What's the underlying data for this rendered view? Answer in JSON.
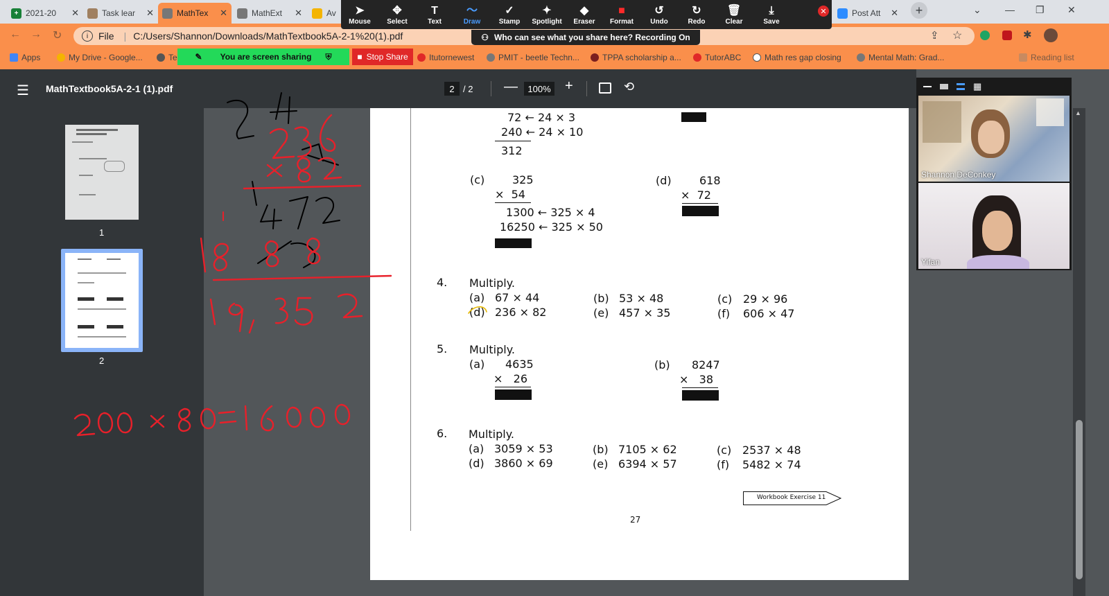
{
  "browser": {
    "tabs": [
      {
        "title": "2021-20",
        "fav_color": "#188038",
        "fav_glyph": "+"
      },
      {
        "title": "Task lear",
        "fav_color": "#a08060",
        "fav_glyph": ""
      },
      {
        "title": "MathTex",
        "fav_color": "#777777",
        "fav_glyph": ""
      },
      {
        "title": "MathExt",
        "fav_color": "#777777",
        "fav_glyph": ""
      },
      {
        "title": "Av",
        "fav_color": "#f4b400",
        "fav_glyph": ""
      },
      {
        "title": "Post Att",
        "fav_color": "#2d8cff",
        "fav_glyph": ""
      }
    ],
    "address": "C:/Users/Shannon/Downloads/MathTextbook5A-2-1%20(1).pdf",
    "file_label": "File",
    "bookmarks": [
      "Apps",
      "My Drive - Google...",
      "Te",
      "Itutornewest",
      "PMIT - beetle Techn...",
      "TPPA scholarship a...",
      "TutorABC",
      "Math res gap closing",
      "Mental Math: Grad...",
      "Reading list"
    ]
  },
  "annotate_toolbar": {
    "tools": [
      {
        "label": "Mouse",
        "icon": "mouse-icon",
        "glyph": "➤"
      },
      {
        "label": "Select",
        "icon": "select-icon",
        "glyph": "✥"
      },
      {
        "label": "Text",
        "icon": "text-icon",
        "glyph": "T"
      },
      {
        "label": "Draw",
        "icon": "draw-icon",
        "glyph": "〜"
      },
      {
        "label": "Stamp",
        "icon": "stamp-icon",
        "glyph": "✓"
      },
      {
        "label": "Spotlight",
        "icon": "spotlight-icon",
        "glyph": "✦"
      },
      {
        "label": "Eraser",
        "icon": "eraser-icon",
        "glyph": "◆"
      },
      {
        "label": "Format",
        "icon": "format-icon",
        "glyph": "■"
      },
      {
        "label": "Undo",
        "icon": "undo-icon",
        "glyph": "↺"
      },
      {
        "label": "Redo",
        "icon": "redo-icon",
        "glyph": "↻"
      },
      {
        "label": "Clear",
        "icon": "trash-icon",
        "glyph": "🗑"
      },
      {
        "label": "Save",
        "icon": "save-icon",
        "glyph": "⤓"
      }
    ],
    "active_tool": "Draw",
    "banner": "Who can see what you share here? Recording On",
    "sharing_status": "You are screen sharing",
    "stop_share": "Stop Share"
  },
  "pdf": {
    "title": "MathTextbook5A-2-1 (1).pdf",
    "current_page": "2",
    "total_pages": "/ 2",
    "zoom": "100%",
    "thumbs": [
      "1",
      "2"
    ],
    "page_number": "27",
    "workbook_tag": "Workbook Exercise 11"
  },
  "problem_top": {
    "row1": "72 ← 24 × 3",
    "row2": "240 ← 24 × 10",
    "total": "312"
  },
  "problem_c": {
    "label": "(c)",
    "top": "325",
    "bottom": "×  54",
    "p1": "1300 ← 325 × 4",
    "p2": "16250 ← 325 × 50"
  },
  "problem_d": {
    "label": "(d)",
    "top": "618",
    "bottom": "×  72"
  },
  "q4": {
    "num": "4.",
    "title": "Multiply.",
    "items": [
      {
        "l": "(a)",
        "e": "67 × 44"
      },
      {
        "l": "(b)",
        "e": "53 × 48"
      },
      {
        "l": "(c)",
        "e": "29 × 96"
      },
      {
        "l": "(d)",
        "e": "236 × 82"
      },
      {
        "l": "(e)",
        "e": "457 × 35"
      },
      {
        "l": "(f)",
        "e": "606 × 47"
      }
    ]
  },
  "q5": {
    "num": "5.",
    "title": "Multiply.",
    "a": {
      "label": "(a)",
      "top": "4635",
      "bottom": "×   26"
    },
    "b": {
      "label": "(b)",
      "top": "8247",
      "bottom": "×   38"
    }
  },
  "q6": {
    "num": "6.",
    "title": "Multiply.",
    "items": [
      {
        "l": "(a)",
        "e": "3059 × 53"
      },
      {
        "l": "(b)",
        "e": "7105 × 62"
      },
      {
        "l": "(c)",
        "e": "2537 × 48"
      },
      {
        "l": "(d)",
        "e": "3860 × 69"
      },
      {
        "l": "(e)",
        "e": "6394 × 57"
      },
      {
        "l": "(f)",
        "e": "5482 × 74"
      }
    ]
  },
  "participants": [
    {
      "name": "Shannon DeConkey"
    },
    {
      "name": "Yifan"
    }
  ],
  "colors": {
    "annotation_red": "#e8202a",
    "annotation_black": "#000000",
    "tab_accent": "#fa8f4b"
  }
}
